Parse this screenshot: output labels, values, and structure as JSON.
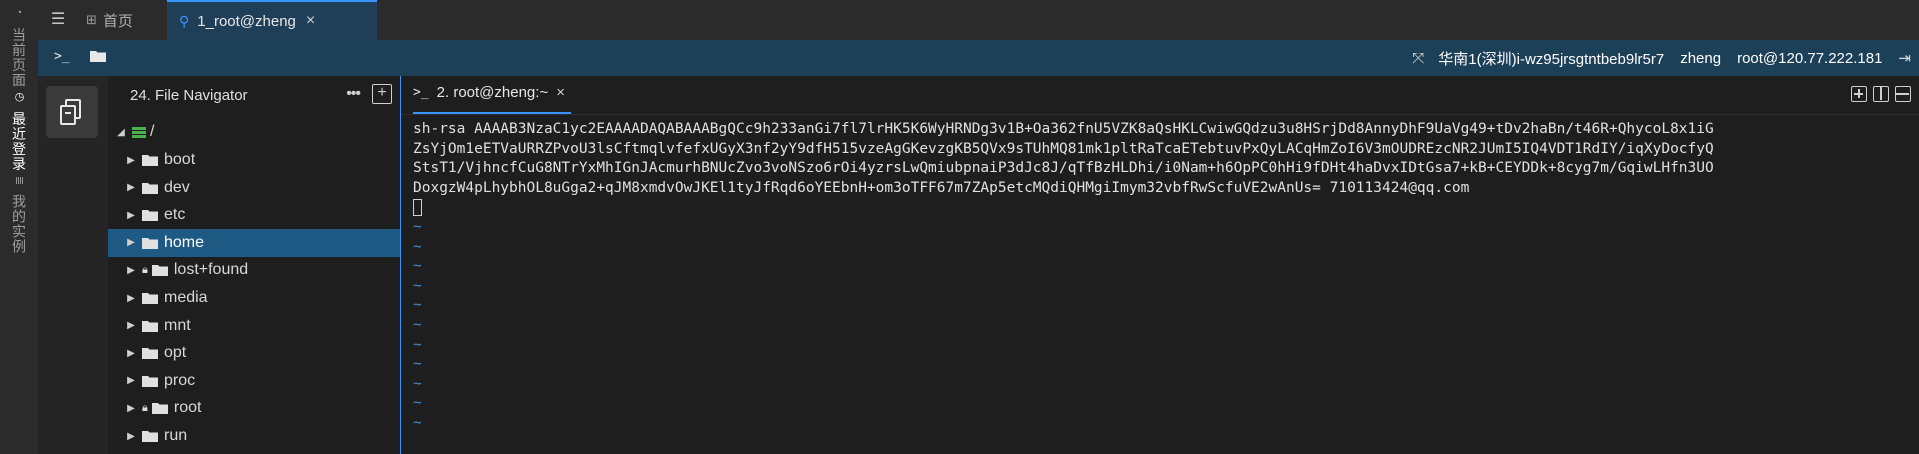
{
  "left_rail": {
    "tabs": [
      {
        "label": "当前页面",
        "icon": "clock-icon"
      },
      {
        "label": "最近登录",
        "icon": "history-icon"
      },
      {
        "label": "我的实例",
        "icon": "list-icon"
      }
    ],
    "active": "最近登录"
  },
  "top_tabs": {
    "home_label": "首页",
    "session_label": "1_root@zheng"
  },
  "toolbar": {
    "region": "华南1(深圳)i-wz95jrsgtntbeb9lr5r7",
    "user": "zheng",
    "host": "root@120.77.222.181"
  },
  "file_navigator": {
    "title": "24. File Navigator",
    "root": "/",
    "items": [
      {
        "name": "boot",
        "locked": false,
        "selected": false
      },
      {
        "name": "dev",
        "locked": false,
        "selected": false
      },
      {
        "name": "etc",
        "locked": false,
        "selected": false
      },
      {
        "name": "home",
        "locked": false,
        "selected": true
      },
      {
        "name": "lost+found",
        "locked": true,
        "selected": false
      },
      {
        "name": "media",
        "locked": false,
        "selected": false
      },
      {
        "name": "mnt",
        "locked": false,
        "selected": false
      },
      {
        "name": "opt",
        "locked": false,
        "selected": false
      },
      {
        "name": "proc",
        "locked": false,
        "selected": false
      },
      {
        "name": "root",
        "locked": true,
        "selected": false
      },
      {
        "name": "run",
        "locked": false,
        "selected": false
      }
    ]
  },
  "terminal": {
    "tab_label": "2. root@zheng:~",
    "lines": [
      "sh-rsa AAAAB3NzaC1yc2EAAAADAQABAAABgQCc9h233anGi7fl7lrHK5K6WyHRNDg3v1B+Oa362fnU5VZK8aQsHKLCwiwGQdzu3u8HSrjDd8AnnyDhF9UaVg49+tDv2haBn/t46R+QhycoL8x1iG",
      "ZsYjOm1eETVaURRZPvoU3lsCftmqlvfefxUGyX3nf2yY9dfH515vzeAgGKevzgKB5QVx9sTUhMQ81mk1pltRaTcaETebtuvPxQyLACqHmZoI6V3mOUDREzcNR2JUmI5IQ4VDT1RdIY/iqXyDocfyQ",
      "StsT1/VjhncfCuG8NTrYxMhIGnJAcmurhBNUcZvo3voNSzo6rOi4yzrsLwQmiubpnaiP3dJc8J/qTfBzHLDhi/i0Nam+h6OpPC0hHi9fDHt4haDvxIDtGsa7+kB+CEYDDk+8cyg7m/GqiwLHfn3UO",
      "DoxgzW4pLhybhOL8uGga2+qJM8xmdvOwJKEl1tyJfRqd6oYEEbnH+om3oTFF67m7ZAp5etcMQdiQHMgiImym32vbfRwScfuVE2wAnUs= 710113424@qq.com"
    ],
    "tilde_char": "~",
    "tilde_count": 11
  },
  "colors": {
    "accent": "#3794ff",
    "selection": "#1f5a85",
    "toolbar_bg": "#1d4059",
    "tilde": "#3a8fd6"
  }
}
